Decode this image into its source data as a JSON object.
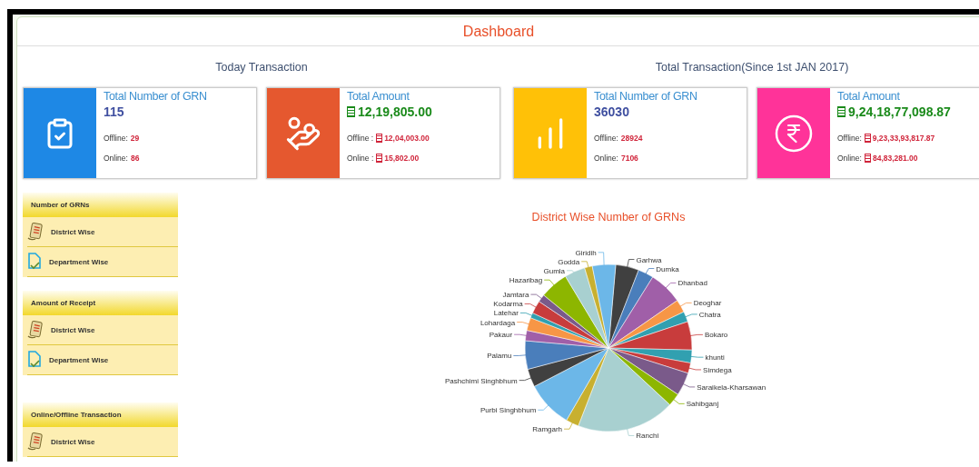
{
  "header": {
    "title": "Dashboard"
  },
  "sections": [
    {
      "title": "Today Transaction",
      "cards": [
        {
          "color": "#1e88e5",
          "title": "Total Number of GRN",
          "value": "115",
          "currency": false,
          "rows": [
            {
              "label": "Offline:",
              "value": "29",
              "currency": false
            },
            {
              "label": "Online:",
              "value": "86",
              "currency": false
            }
          ]
        },
        {
          "color": "#e5582f",
          "title": "Total Amount",
          "value": "12,19,805.00",
          "currency": true,
          "rows": [
            {
              "label": "Offline :",
              "value": "12,04,003.00",
              "currency": true
            },
            {
              "label": "Online :",
              "value": "15,802.00",
              "currency": true
            }
          ]
        }
      ]
    },
    {
      "title": "Total Transaction(Since 1st JAN 2017)",
      "cards": [
        {
          "color": "#ffc107",
          "title": "Total Number of GRN",
          "value": "36030",
          "currency": false,
          "rows": [
            {
              "label": "Offline:",
              "value": "28924",
              "currency": false
            },
            {
              "label": "Online:",
              "value": "7106",
              "currency": false
            }
          ]
        },
        {
          "color": "#ff3399",
          "title": "Total Amount",
          "value": "9,24,18,77,098.87",
          "currency": true,
          "rows": [
            {
              "label": "Offline:",
              "value": "9,23,33,93,817.87",
              "currency": true
            },
            {
              "label": "Online:",
              "value": "84,83,281.00",
              "currency": true
            }
          ]
        }
      ]
    }
  ],
  "menus": [
    {
      "title": "Number of GRNs",
      "items": [
        {
          "label": "District Wise"
        },
        {
          "label": "Department Wise"
        }
      ]
    },
    {
      "title": "Amount of Receipt",
      "items": [
        {
          "label": "District Wise"
        },
        {
          "label": "Department Wise"
        }
      ]
    },
    {
      "title": "Online/Offline Transaction",
      "items": [
        {
          "label": "District Wise"
        }
      ]
    }
  ],
  "chart": {
    "chart_data": {
      "type": "pie",
      "title": "District Wise Number of GRNs",
      "categories": [
        "Garhwa",
        "Dumka",
        "Dhanbad",
        "Deoghar",
        "Chatra",
        "Bokaro",
        "khunti",
        "Simdega",
        "Saraikela-Kharsawan",
        "Sahibganj",
        "Ranchi",
        "Ramgarh",
        "Purbi Singhbhum",
        "Pashchimi Singhbhum",
        "Palamu",
        "Pakaur",
        "Lohardaga",
        "Latehar",
        "Kodarma",
        "Jamtara",
        "Hazaribag",
        "Gumla",
        "Godda",
        "Giridih"
      ],
      "values": [
        4.5,
        3,
        6.5,
        2.5,
        2,
        5.5,
        2.5,
        2,
        4.5,
        2.5,
        19,
        2.5,
        9,
        3.5,
        5.5,
        2,
        2.5,
        1,
        2.5,
        1.5,
        5.5,
        4,
        1.5,
        4.5
      ],
      "colors": [
        "#404040",
        "#4a7ebb",
        "#a05fa8",
        "#f79646",
        "#31a0b0",
        "#c83c3c",
        "#31a0b0",
        "#c83c3c",
        "#7a5a8a",
        "#8db600",
        "#a8d0d0",
        "#c8b030",
        "#6cb7e8",
        "#404040",
        "#4a7ebb",
        "#a05fa8",
        "#f79646",
        "#31a0b0",
        "#c83c3c",
        "#7a5a8a",
        "#8db600",
        "#a8d0d0",
        "#c8b030",
        "#6cb7e8"
      ]
    }
  }
}
